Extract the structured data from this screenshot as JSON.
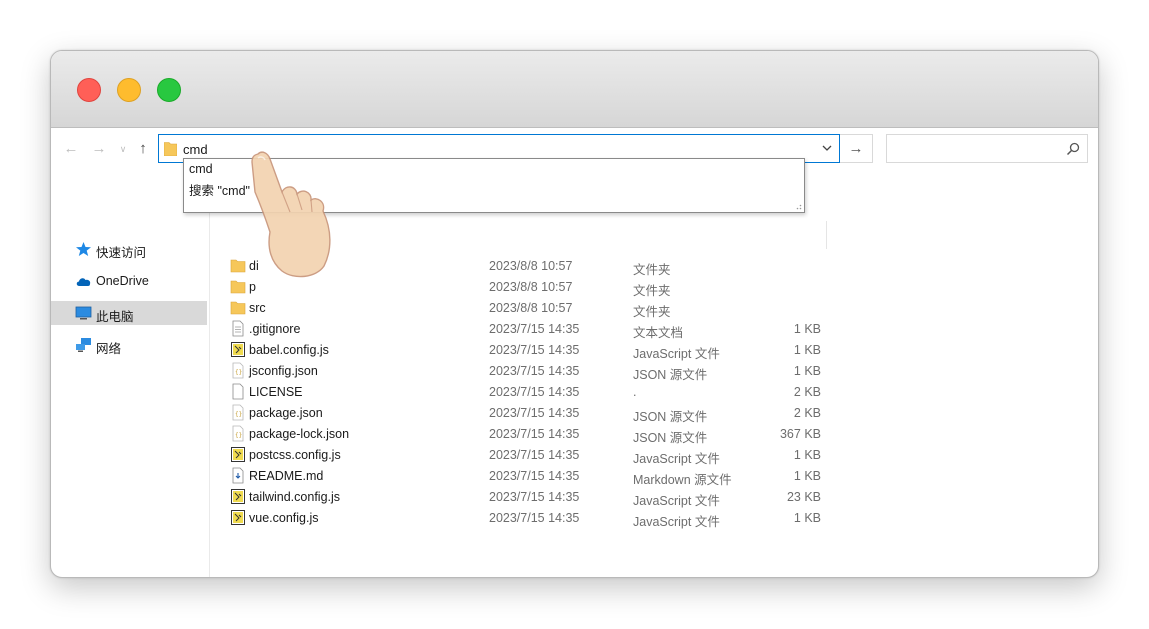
{
  "address_bar": {
    "value": "cmd"
  },
  "autocomplete": {
    "items": [
      "cmd",
      "搜索 \"cmd\""
    ]
  },
  "search": {
    "placeholder": ""
  },
  "sidebar": {
    "items": [
      {
        "label": "快速访问",
        "icon": "star-icon"
      },
      {
        "label": "OneDrive",
        "icon": "cloud-icon"
      },
      {
        "label": "此电脑",
        "icon": "computer-icon",
        "selected": true
      },
      {
        "label": "网络",
        "icon": "network-icon"
      }
    ]
  },
  "files": [
    {
      "name": "di",
      "date": "2023/8/8 10:57",
      "type": "文件夹",
      "size": "",
      "icon": "folder-icon"
    },
    {
      "name": "p",
      "date": "2023/8/8 10:57",
      "type": "文件夹",
      "size": "",
      "icon": "folder-icon"
    },
    {
      "name": "src",
      "date": "2023/8/8 10:57",
      "type": "文件夹",
      "size": "",
      "icon": "folder-icon"
    },
    {
      "name": ".gitignore",
      "date": "2023/7/15 14:35",
      "type": "文本文档",
      "size": "1 KB",
      "icon": "text-file-icon"
    },
    {
      "name": "babel.config.js",
      "date": "2023/7/15 14:35",
      "type": "JavaScript 文件",
      "size": "1 KB",
      "icon": "js-file-icon"
    },
    {
      "name": "jsconfig.json",
      "date": "2023/7/15 14:35",
      "type": "JSON 源文件",
      "size": "1 KB",
      "icon": "json-file-icon"
    },
    {
      "name": "LICENSE",
      "date": "2023/7/15 14:35",
      "type": ".",
      "size": "2 KB",
      "icon": "blank-file-icon"
    },
    {
      "name": "package.json",
      "date": "2023/7/15 14:35",
      "type": "JSON 源文件",
      "size": "2 KB",
      "icon": "json-file-icon"
    },
    {
      "name": "package-lock.json",
      "date": "2023/7/15 14:35",
      "type": "JSON 源文件",
      "size": "367 KB",
      "icon": "json-file-icon"
    },
    {
      "name": "postcss.config.js",
      "date": "2023/7/15 14:35",
      "type": "JavaScript 文件",
      "size": "1 KB",
      "icon": "js-file-icon"
    },
    {
      "name": "README.md",
      "date": "2023/7/15 14:35",
      "type": "Markdown 源文件",
      "size": "1 KB",
      "icon": "markdown-file-icon"
    },
    {
      "name": "tailwind.config.js",
      "date": "2023/7/15 14:35",
      "type": "JavaScript 文件",
      "size": "23 KB",
      "icon": "js-file-icon"
    },
    {
      "name": "vue.config.js",
      "date": "2023/7/15 14:35",
      "type": "JavaScript 文件",
      "size": "1 KB",
      "icon": "js-file-icon"
    }
  ],
  "colors": {
    "accent": "#0078d4",
    "folder": "#f6c75a",
    "selection": "#d9d9d9"
  }
}
